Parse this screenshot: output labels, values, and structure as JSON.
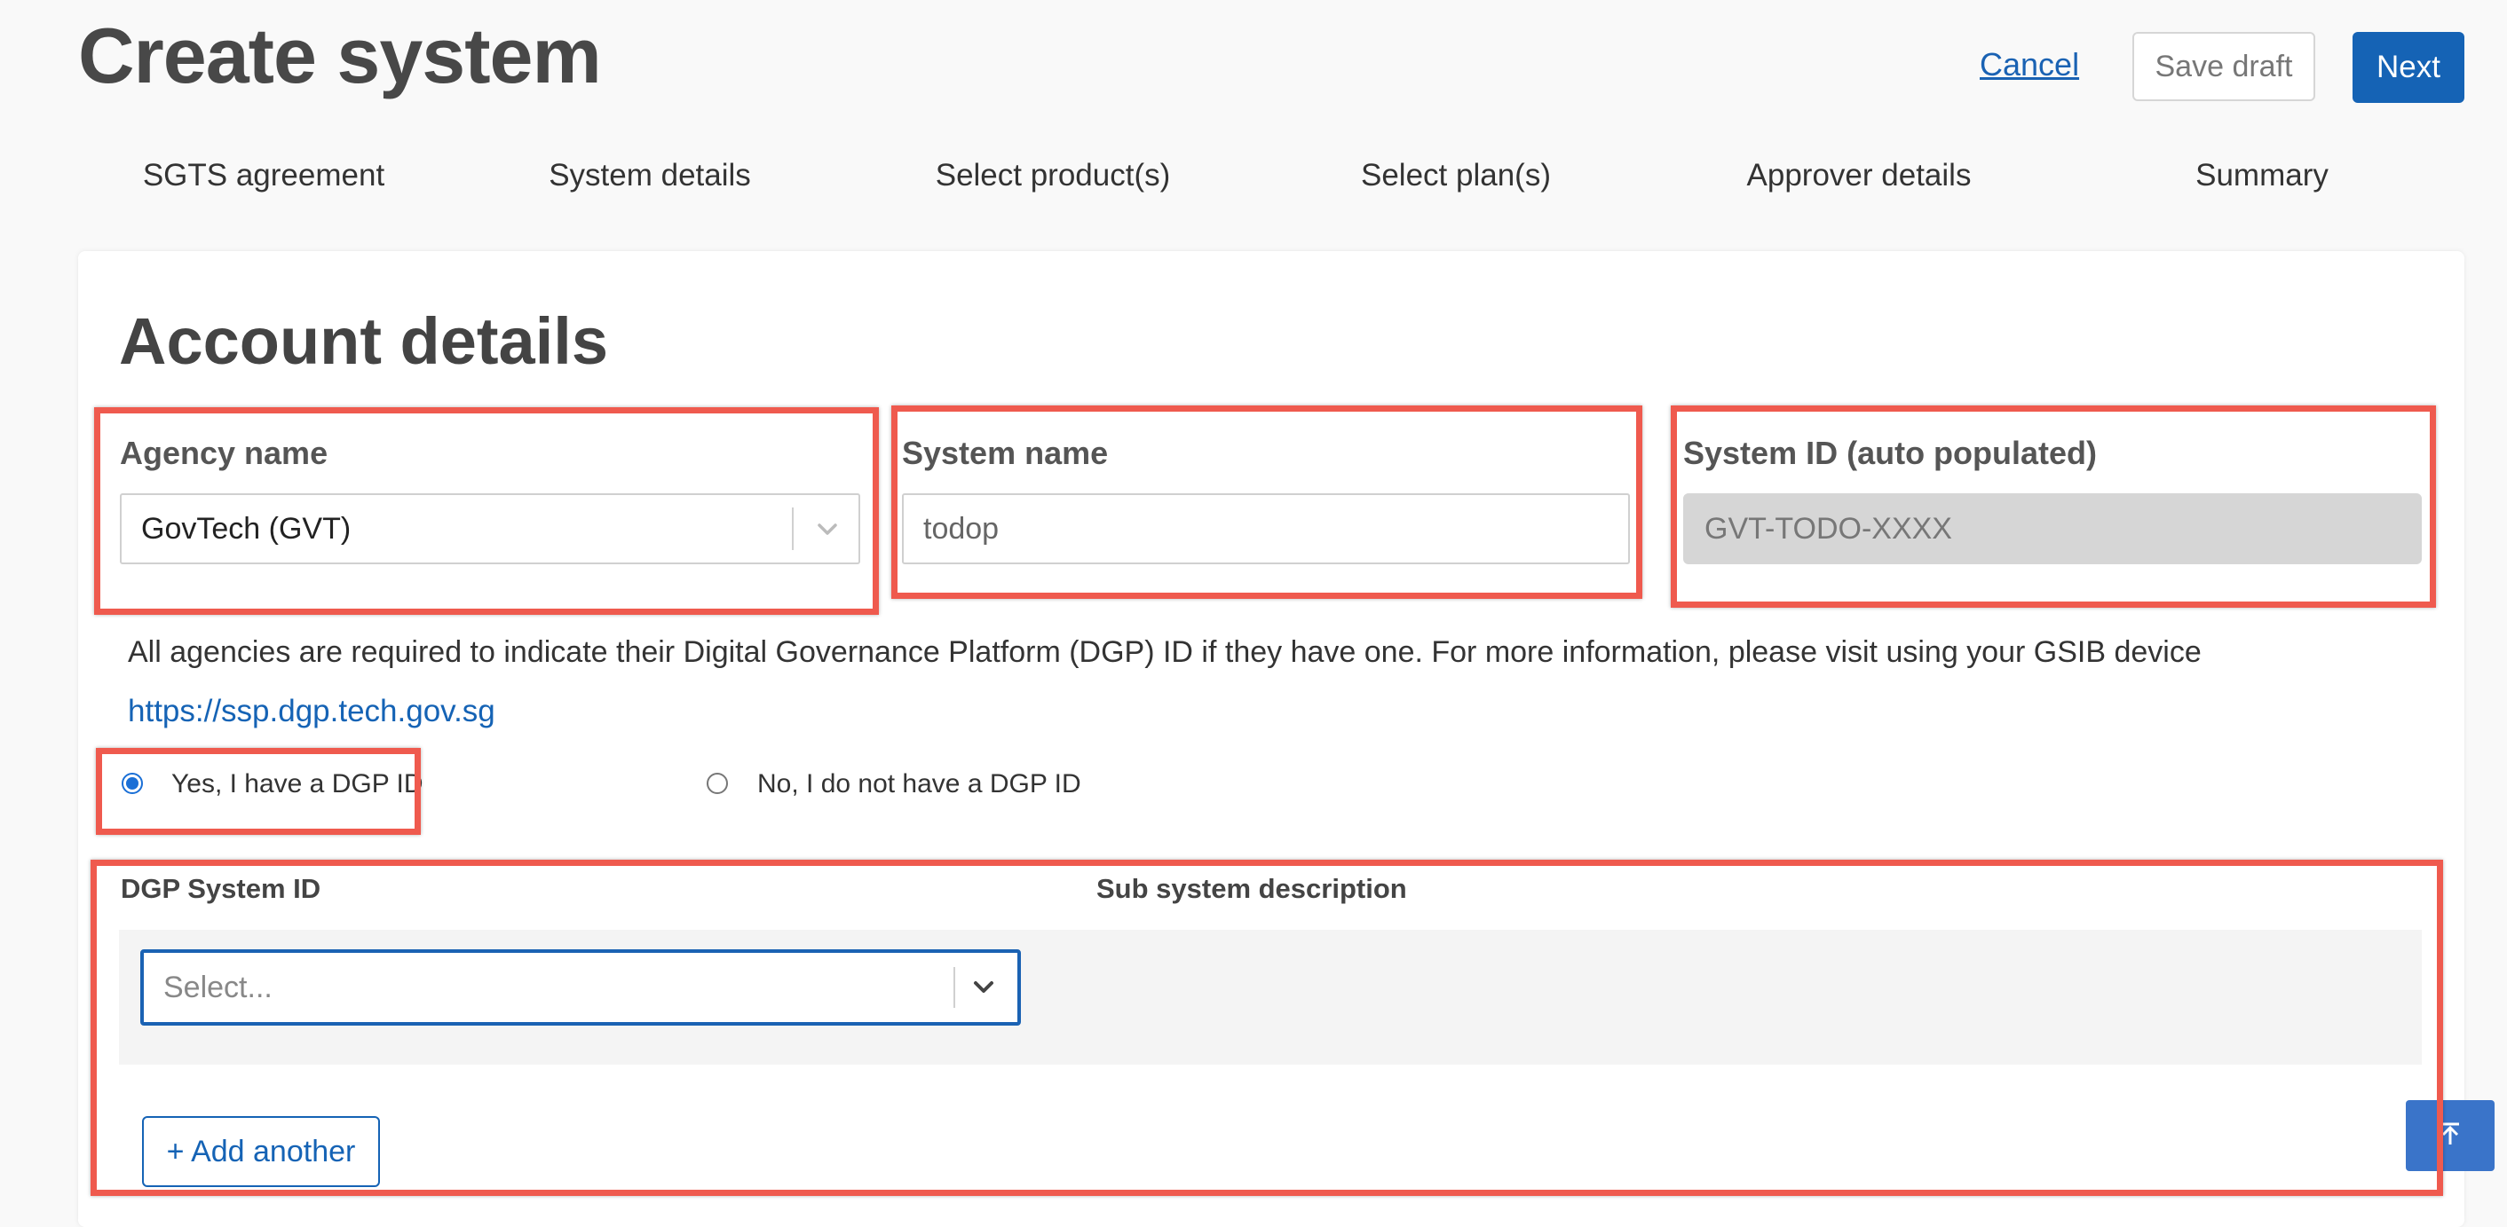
{
  "header": {
    "title": "Create system",
    "cancel_label": "Cancel",
    "save_draft_label": "Save draft",
    "next_label": "Next"
  },
  "steps": [
    {
      "label": "SGTS agreement"
    },
    {
      "label": "System details"
    },
    {
      "label": "Select product(s)"
    },
    {
      "label": "Select plan(s)"
    },
    {
      "label": "Approver details"
    },
    {
      "label": "Summary"
    }
  ],
  "account": {
    "title": "Account details",
    "agency": {
      "label": "Agency name",
      "value": "GovTech (GVT)"
    },
    "system_name": {
      "label": "System name",
      "value": "todop"
    },
    "system_id": {
      "label": "System ID (auto populated)",
      "value": "GVT-TODO-XXXX"
    }
  },
  "dgp": {
    "info_text": "All agencies are required to indicate their Digital Governance Platform (DGP) ID if they have one. For more information, please visit using your GSIB device",
    "link": "https://ssp.dgp.tech.gov.sg",
    "radio_yes": "Yes, I have a DGP ID",
    "radio_no": "No, I do not have a DGP ID",
    "selected": "yes",
    "system_id_label": "DGP System ID",
    "sub_desc_label": "Sub system description",
    "select_placeholder": "Select...",
    "add_another_label": "+ Add another"
  },
  "colors": {
    "primary": "#1563b5",
    "highlight": "#ef5a4e"
  },
  "icons": {
    "chevron": "chevron-down-icon",
    "scroll_top": "arrow-to-top-icon"
  }
}
